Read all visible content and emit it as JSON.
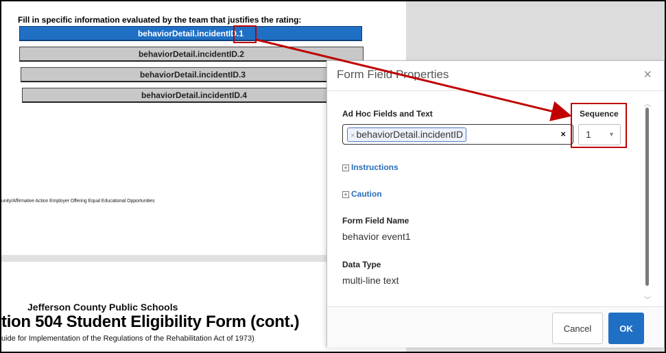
{
  "document": {
    "heading": "Fill in specific information evaluated by the team that justifies the rating:",
    "fields": [
      "behaviorDetail.incidentID.1",
      "behaviorDetail.incidentID.2",
      "behaviorDetail.incidentID.3",
      "behaviorDetail.incidentID.4"
    ],
    "footer_text": "unity/Affirmative Action Employer Offering Equal Educational Opportunities",
    "org_name": "Jefferson County Public Schools",
    "form_title": "tion 504 Student Eligibility Form (cont.)",
    "form_subtitle": "uide for Implementation of the Regulations of the Rehabilitation Act of 1973)"
  },
  "modal": {
    "title": "Form Field Properties",
    "close_label": "×",
    "adhoc_label": "Ad Hoc Fields and Text",
    "adhoc_chip": "behaviorDetail.incidentID",
    "chip_remove": "×",
    "clear_label": "×",
    "sequence_label": "Sequence",
    "sequence_value": "1",
    "instructions_label": "Instructions",
    "caution_label": "Caution",
    "field_name_label": "Form Field Name",
    "field_name_value": "behavior event1",
    "data_type_label": "Data Type",
    "data_type_value": "multi-line text",
    "cancel_label": "Cancel",
    "ok_label": "OK"
  },
  "colors": {
    "accent": "#1f6fc5",
    "annotation": "#c00000"
  }
}
